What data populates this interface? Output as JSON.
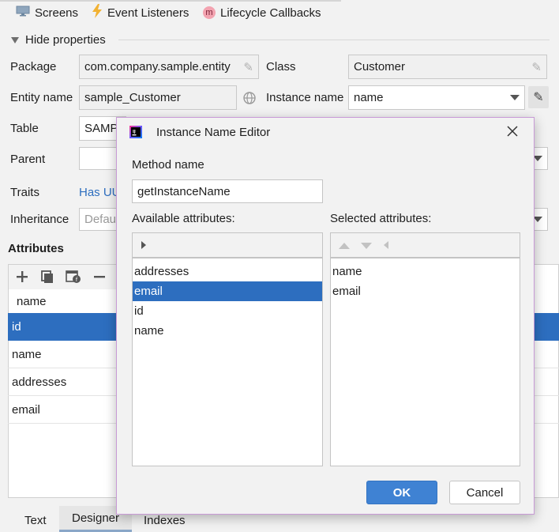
{
  "top_tabs": [
    {
      "label": "Screens",
      "icon": "monitor-icon"
    },
    {
      "label": "Event Listeners",
      "icon": "lightning-icon"
    },
    {
      "label": "Lifecycle Callbacks",
      "icon": "method-icon",
      "badge": "m"
    }
  ],
  "properties": {
    "toggle_label": "Hide properties",
    "package_label": "Package",
    "package_value": "com.company.sample.entity",
    "class_label": "Class",
    "class_value": "Customer",
    "entity_name_label": "Entity name",
    "entity_name_value": "sample_Customer",
    "instance_name_label": "Instance name",
    "instance_name_value": "name",
    "table_label": "Table",
    "table_value": "SAMP",
    "parent_label": "Parent",
    "traits_label": "Traits",
    "traits_value": "Has UU",
    "inheritance_label": "Inheritance",
    "inheritance_value": "Defau"
  },
  "attributes": {
    "title": "Attributes",
    "column_header": "name",
    "rows": [
      "id",
      "name",
      "addresses",
      "email"
    ],
    "selected_index": 0
  },
  "bottom_tabs": [
    "Text",
    "Designer",
    "Indexes"
  ],
  "dialog": {
    "title": "Instance Name Editor",
    "method_name_label": "Method name",
    "method_name_value": "getInstanceName",
    "available_label": "Available attributes:",
    "available_items": [
      "addresses",
      "email",
      "id",
      "name"
    ],
    "available_selected_index": 1,
    "selected_label": "Selected attributes:",
    "selected_items": [
      "name",
      "email"
    ],
    "ok_label": "OK",
    "cancel_label": "Cancel"
  },
  "colors": {
    "selection": "#2d6ebf",
    "ok_button": "#3f82d3",
    "dialog_border": "#c89ad6"
  }
}
